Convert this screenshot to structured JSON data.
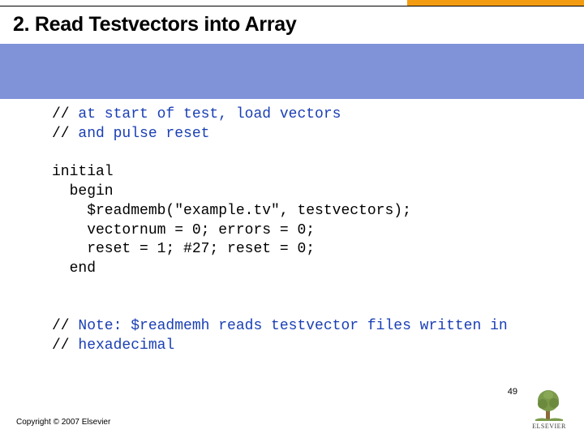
{
  "slide": {
    "number": "2.",
    "title": "Read Testvectors into Array"
  },
  "code": {
    "comment1_a": "// ",
    "comment1_b": "at start of test, load vectors",
    "comment2_a": "// ",
    "comment2_b": "and pulse reset",
    "l1": "initial",
    "l2": "  begin",
    "l3": "    $readmemb(\"example.tv\", testvectors);",
    "l4": "    vectornum = 0; errors = 0;",
    "l5": "    reset = 1; #27; reset = 0;",
    "l6": "  end",
    "note1_a": "// ",
    "note1_b": "Note: $readmemh reads testvector files written in",
    "note2_a": "// ",
    "note2_b": "hexadecimal"
  },
  "footer": {
    "copyright": "Copyright © 2007 Elsevier",
    "page": "49",
    "publisher": "ELSEVIER"
  }
}
